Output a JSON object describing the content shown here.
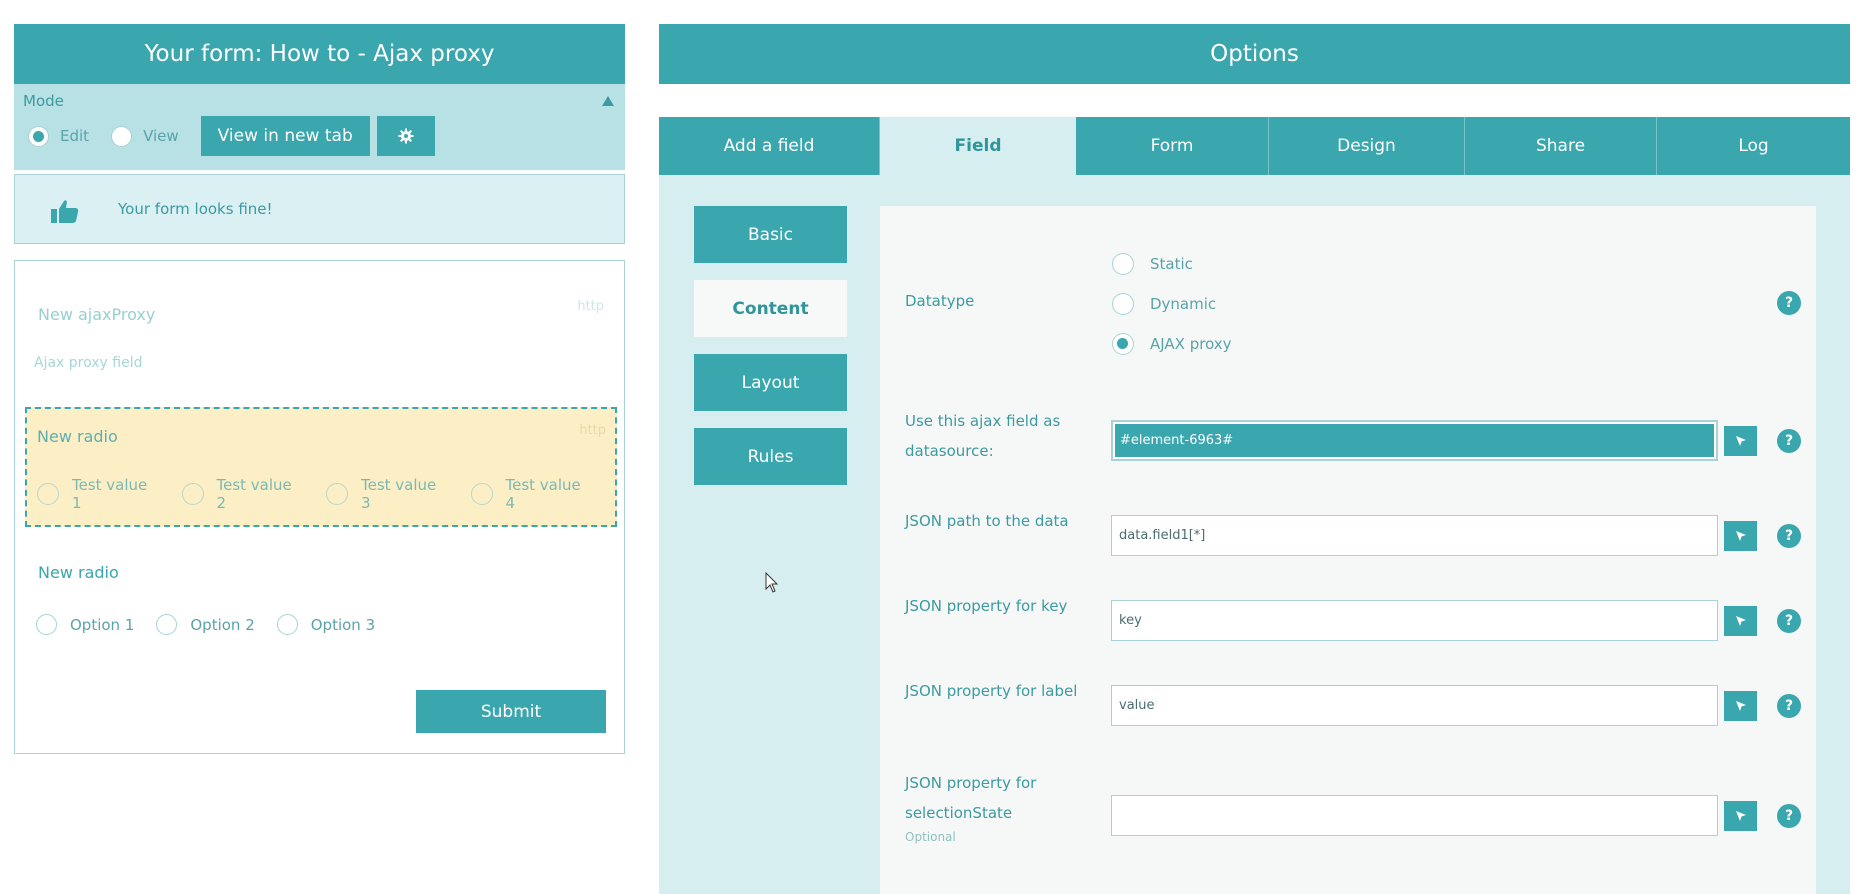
{
  "left": {
    "title": "Your form: How to - Ajax proxy",
    "mode": {
      "label": "Mode",
      "options": [
        "Edit",
        "View"
      ],
      "selected": "Edit",
      "view_new_tab": "View in new tab"
    },
    "status": "Your form looks fine!",
    "preview": {
      "field1": {
        "title": "New ajaxProxy",
        "hint": "http",
        "subtitle": "Ajax proxy field"
      },
      "field2": {
        "title": "New radio",
        "hint": "http",
        "options": [
          "Test value 1",
          "Test value 2",
          "Test value 3",
          "Test value 4"
        ]
      },
      "field3": {
        "title": "New radio",
        "options": [
          "Option 1",
          "Option 2",
          "Option 3"
        ]
      },
      "submit": "Submit"
    }
  },
  "right": {
    "title": "Options",
    "tabs": [
      "Add a field",
      "Field",
      "Form",
      "Design",
      "Share",
      "Log"
    ],
    "active_tab": "Field",
    "subnav": [
      "Basic",
      "Content",
      "Layout",
      "Rules"
    ],
    "active_subnav": "Content",
    "datatype": {
      "label": "Datatype",
      "options": [
        "Static",
        "Dynamic",
        "AJAX proxy"
      ],
      "selected": "AJAX proxy"
    },
    "rows": {
      "datasource": {
        "label_line1": "Use this ajax field as",
        "label_line2": "datasource:",
        "value": "#element-6963#"
      },
      "json_path": {
        "label": "JSON path to the data",
        "value": "data.field1[*]"
      },
      "json_key": {
        "label": "JSON property for key",
        "value": "key"
      },
      "json_label": {
        "label": "JSON property for label",
        "value": "value"
      },
      "json_selection": {
        "label_line1": "JSON property for",
        "label_line2": "selectionState",
        "optional": "Optional",
        "value": ""
      }
    },
    "help_glyph": "?"
  },
  "colors": {
    "primary": "#3aa6ad",
    "mode_bar": "#b7e1e5",
    "panel_bg": "#d7eef0",
    "selected_field_bg": "#fcefc5"
  }
}
